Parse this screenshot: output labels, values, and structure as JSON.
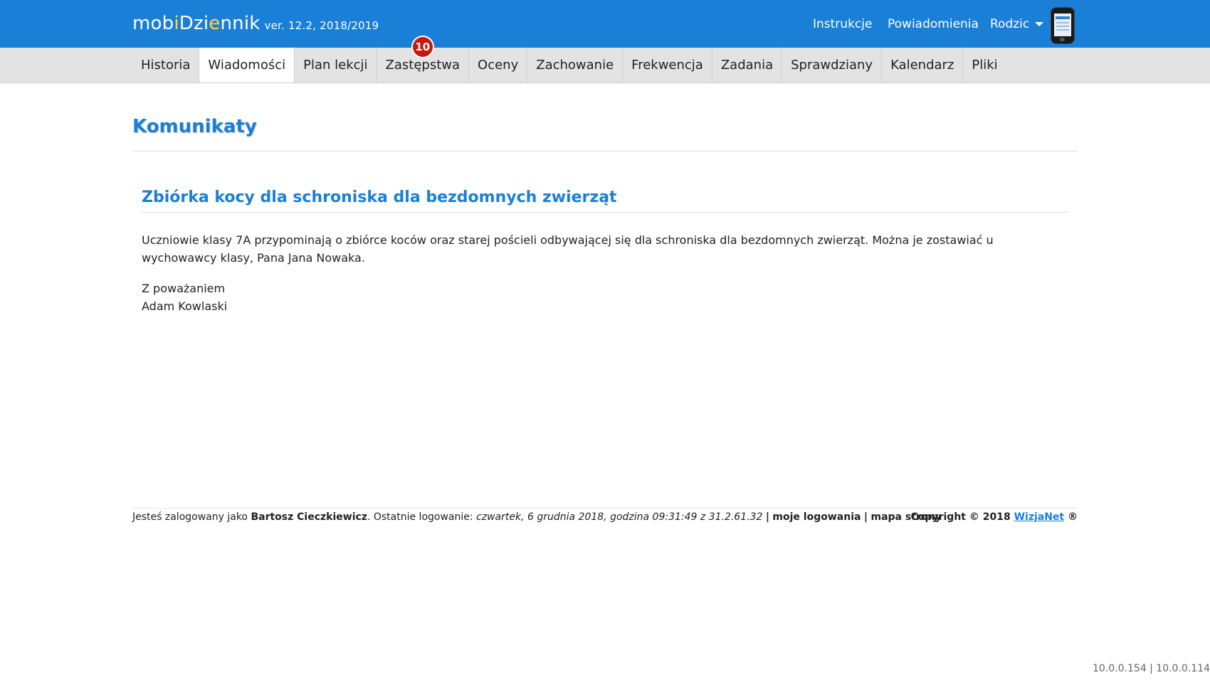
{
  "header": {
    "brand_pre": "mob",
    "brand_i1": "i",
    "brand_mid": "Dzi",
    "brand_e": "e",
    "brand_post": "nnik",
    "version": "ver. 12.2, 2018/2019",
    "links": [
      "Instrukcje",
      "Powiadomienia"
    ],
    "role": "Rodzic",
    "device_icon": "smartphone-icon"
  },
  "nav": {
    "items": [
      "Historia",
      "Wiadomości",
      "Plan lekcji",
      "Zastępstwa",
      "Oceny",
      "Zachowanie",
      "Frekwencja",
      "Zadania",
      "Sprawdziany",
      "Kalendarz",
      "Pliki"
    ],
    "active": "Wiadomości",
    "badge_count": "10"
  },
  "main": {
    "title": "Komunikaty",
    "message": {
      "title": "Zbiórka kocy dla schroniska dla bezdomnych zwierząt",
      "body": "Uczniowie klasy 7A przypominają o zbiórce koców oraz starej pościeli odbywającej się dla schroniska dla bezdomnych zwierząt. Można je zostawiać u wychowawcy klasy, Pana Jana Nowaka.",
      "greeting": "Z poważaniem",
      "signature": "Adam Kowlaski"
    }
  },
  "footer": {
    "logged_prefix": "Jesteś zalogowany jako",
    "user": "Bartosz Cieczkiewicz",
    "last_login_prefix": ". Ostatnie logowanie:",
    "last_login": "czwartek, 6 grudnia 2018, godzina 09:31:49 z 31.2.61.32",
    "sep": "|",
    "my_logins": "moje logowania",
    "sitemap": "mapa strony",
    "copyright": "Copyright © 2018",
    "company": "WizjaNet",
    "reg": "®",
    "ips": "10.0.0.154 | 10.0.0.114"
  },
  "colors": {
    "header_bg": "#1a7fd6",
    "accent": "#1a7fd6",
    "badge": "#c8170d",
    "brand_highlight": "#ffd93b"
  }
}
